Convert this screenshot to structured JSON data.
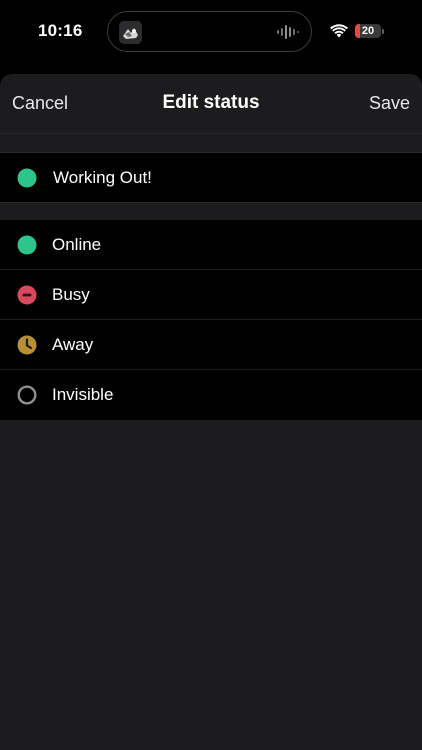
{
  "status_bar": {
    "time": "10:16",
    "battery_level": "20",
    "battery_percent": 0.2,
    "battery_color": "#e5493f"
  },
  "header": {
    "cancel_label": "Cancel",
    "title": "Edit status",
    "save_label": "Save"
  },
  "custom_status": {
    "text": "Working Out!",
    "icon": "green-dot-icon",
    "color": "#2dc58a"
  },
  "statuses": [
    {
      "label": "Online",
      "icon": "online-dot-icon",
      "color": "#2dc58a"
    },
    {
      "label": "Busy",
      "icon": "busy-minus-icon",
      "color": "#d9485c"
    },
    {
      "label": "Away",
      "icon": "away-clock-icon",
      "color": "#b78f35"
    },
    {
      "label": "Invisible",
      "icon": "invisible-ring-icon",
      "color": "#8e8e93"
    }
  ]
}
